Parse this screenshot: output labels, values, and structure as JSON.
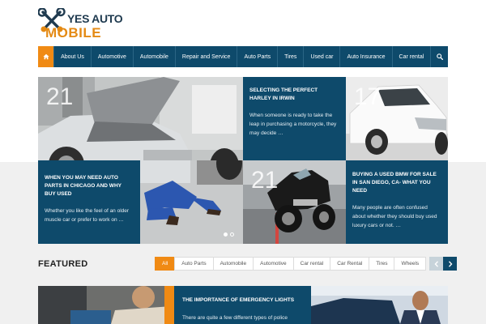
{
  "brand": {
    "line1": "YES AUTO",
    "line2": "MOBILE",
    "icon": "wrench-cross-icon",
    "colors": {
      "navy": "#0e4a6b",
      "orange": "#f08a14",
      "logo_text": "#1f3a4f",
      "logo_accent": "#e48a14"
    }
  },
  "nav": {
    "home_icon": "home-icon",
    "items": [
      "About Us",
      "Automotive",
      "Automobile",
      "Repair and Service",
      "Auto Parts",
      "Tires",
      "Used car",
      "Auto Insurance",
      "Car rental"
    ],
    "search_icon": "search-icon"
  },
  "grid": {
    "tile1": {
      "number": "21",
      "image": "mechanic-under-open-hood"
    },
    "tile2": {
      "title": "SELECTING THE PERFECT HARLEY IN IRWIN",
      "excerpt": "When someone is ready to take the leap in purchasing a motorcycle, they may decide …"
    },
    "tile3": {
      "number": "17",
      "image": "white-sedan"
    },
    "tile4": {
      "title": "WHEN YOU MAY NEED AUTO PARTS IN CHICAGO AND WHY BUY USED",
      "excerpt": "Whether you like the feel of an older muscle car or prefer to work on …"
    },
    "tile5": {
      "number": "21",
      "image": "black-motorcycle"
    },
    "tile6": {
      "title": "BUYING A USED BMW FOR SALE IN SAN DIEGO, CA- WHAT YOU NEED",
      "excerpt": "Many people are often confused about whether they should buy used luxury cars or not. …"
    },
    "slider_dots": 2,
    "active_dot": 0
  },
  "featured": {
    "title": "FEATURED",
    "tabs": [
      "All",
      "Auto Parts",
      "Automobile",
      "Automotive",
      "Car rental",
      "Car Rental",
      "Tires",
      "Wheels"
    ],
    "active_tab": "All",
    "prev_icon": "chevron-left-icon",
    "next_icon": "chevron-right-icon"
  },
  "bottom": {
    "center_title": "THE IMPORTANCE OF EMERGENCY LIGHTS",
    "center_excerpt": "There are quite a few different types of police"
  }
}
